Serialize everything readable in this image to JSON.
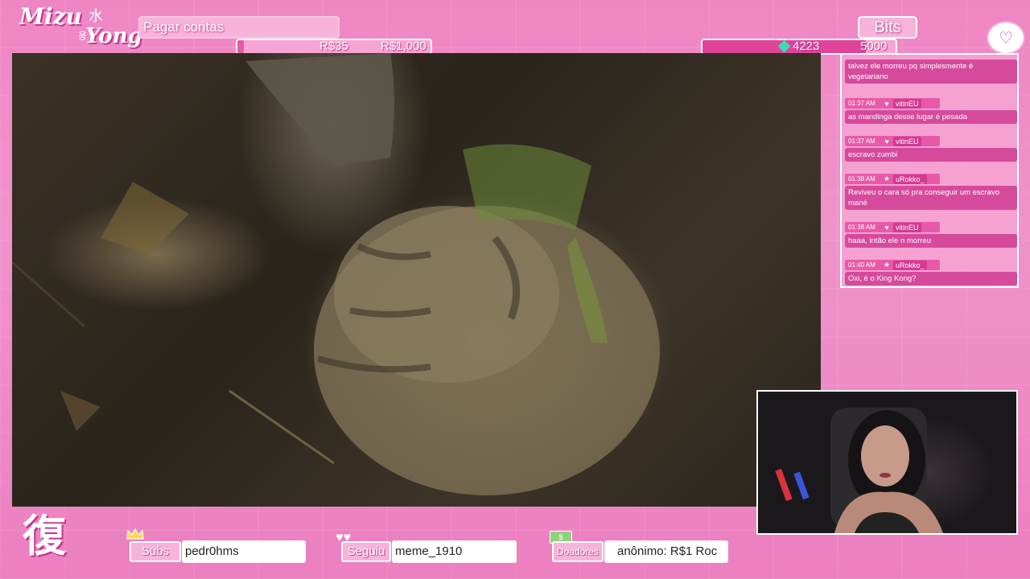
{
  "logo": {
    "mizu": "Mizu",
    "kanji": "水",
    "yong": "Yong",
    "hangul": "용"
  },
  "goal": {
    "title": "Pagar contas",
    "current": "R$35",
    "target": "R$1,000",
    "progress": 0.035
  },
  "bits": {
    "title": "Bits",
    "current": "4223",
    "target": "5000",
    "progress": 0.8446
  },
  "chat": {
    "messages": [
      {
        "time": "",
        "user": "",
        "text": "talvez ele morreu pq simplesmente é vegetariano"
      },
      {
        "time": "01:37 AM",
        "badge": "♥",
        "user": "vitinEU",
        "text": "as mandinga desse lugar é pesada"
      },
      {
        "time": "01:37 AM",
        "badge": "♥",
        "user": "vitinEU",
        "text": "escravo zumbi"
      },
      {
        "time": "01:38 AM",
        "badge": "★",
        "user": "uRokko_",
        "text": "Reviveu o cara só pra conseguir um escravo mané"
      },
      {
        "time": "01:38 AM",
        "badge": "♥",
        "user": "vitinEU",
        "text": "haaa, intão ele n morreu"
      },
      {
        "time": "01:40 AM",
        "badge": "★",
        "user": "uRokko_",
        "text": "Oxi, é o King Kong?"
      }
    ]
  },
  "footer": {
    "subs_label": "Subs",
    "subs_value": "pedr0hms",
    "follow_label": "Seguiu",
    "follow_value": "meme_1910",
    "donors_label": "Doadores",
    "donors_value": "anônimo: R$1   Roc",
    "donors_badge": "$",
    "bottom_logo": "復"
  },
  "colors": {
    "accent": "#e85aa7",
    "background": "#ef86c4"
  },
  "icons": {
    "chat": "heart-chat-icon",
    "bits": "gem-icon",
    "subs": "crown-icon",
    "follow": "hearts-icon",
    "donors": "money-icon"
  }
}
